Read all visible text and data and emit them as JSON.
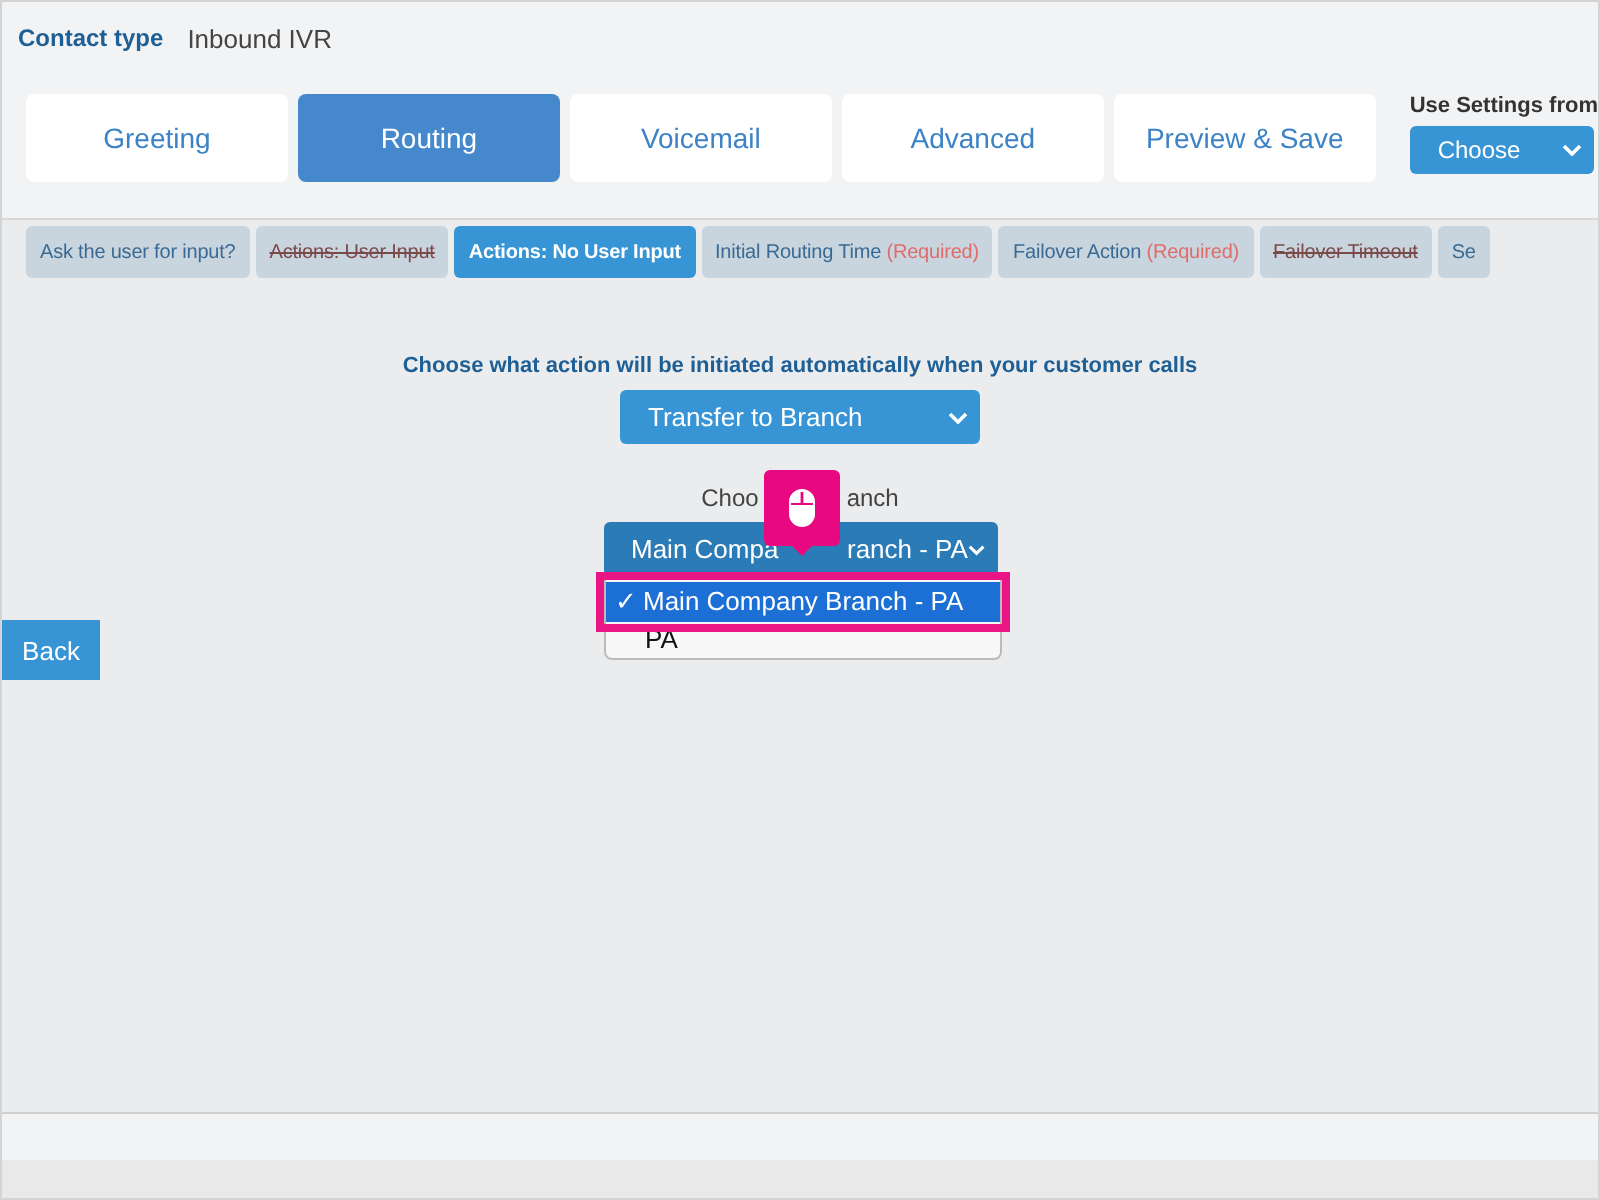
{
  "contact_type": {
    "label": "Contact type",
    "value": "Inbound IVR"
  },
  "tabs": [
    {
      "label": "Greeting",
      "selected": false
    },
    {
      "label": "Routing",
      "selected": true
    },
    {
      "label": "Voicemail",
      "selected": false
    },
    {
      "label": "Advanced",
      "selected": false
    },
    {
      "label": "Preview & Save",
      "selected": false
    }
  ],
  "settings_from": {
    "label": "Use Settings from",
    "button": "Choose"
  },
  "steps": [
    {
      "label": "Ask the user for input?",
      "selected": false,
      "struck": false
    },
    {
      "label": "Actions: User Input",
      "selected": false,
      "struck": true
    },
    {
      "label": "Actions: No User Input",
      "selected": true,
      "struck": false
    },
    {
      "label": "Initial Routing Time",
      "required": "(Required)",
      "selected": false,
      "struck": false
    },
    {
      "label": "Failover Action",
      "required": "(Required)",
      "selected": false,
      "struck": false
    },
    {
      "label": "Failover Timeout",
      "selected": false,
      "struck": true
    },
    {
      "label": "Se",
      "selected": false,
      "struck": false
    }
  ],
  "question": "Choose what action will be initiated automatically when your customer calls",
  "action_select": {
    "value": "Transfer to Branch"
  },
  "branch": {
    "label_parts": [
      "Choo",
      "anch"
    ],
    "value_parts": [
      "Main Compa",
      "ranch - PA"
    ],
    "options": [
      {
        "check": "✓",
        "label": "Main Company Branch - PA",
        "selected": true
      },
      {
        "label": "PA",
        "selected": false
      }
    ]
  },
  "back_button": "Back"
}
